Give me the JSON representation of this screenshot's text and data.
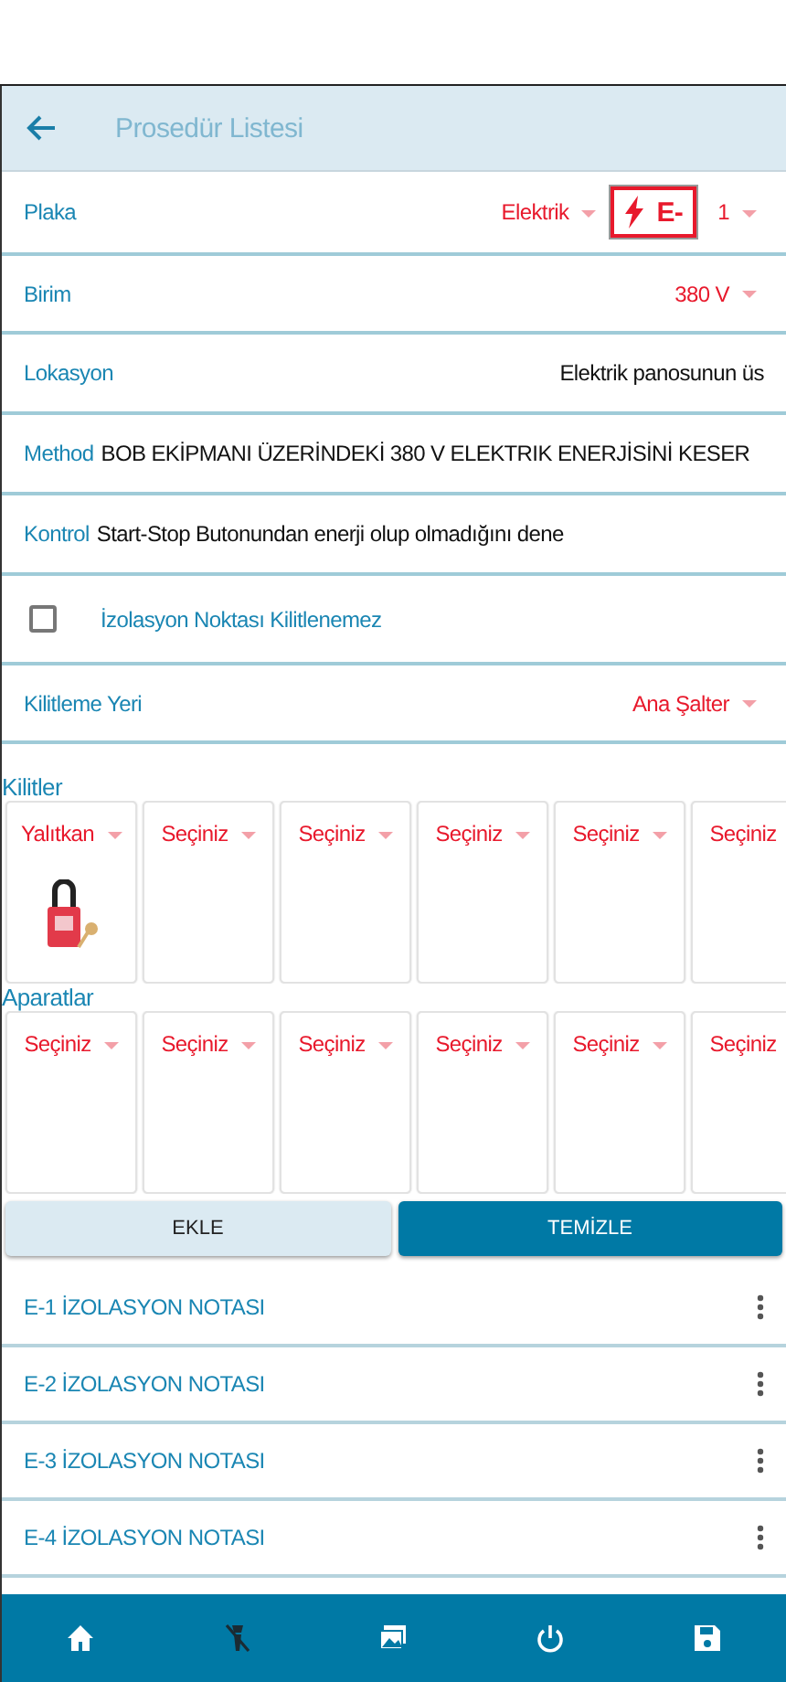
{
  "header": {
    "title": "Prosedür Listesi"
  },
  "fields": [
    {
      "kind": "plaka",
      "label": "Plaka",
      "value": "Elektrik",
      "badge": "E-",
      "number": "1"
    },
    {
      "kind": "select",
      "label": "Birim",
      "value": "380 V"
    },
    {
      "kind": "text",
      "label": "Lokasyon",
      "value": "Elektrik panosunun üs"
    },
    {
      "kind": "inline",
      "label": "Method",
      "value": "BOB EKİPMANI ÜZERİNDEKİ 380 V ELEKTRIK ENERJİSİNİ KESER"
    },
    {
      "kind": "inline",
      "label": "Kontrol",
      "value": "Start-Stop Butonundan enerji olup olmadığını dene"
    },
    {
      "kind": "checkbox",
      "label": "İzolasyon Noktası Kilitlenemez",
      "checked": false
    },
    {
      "kind": "select",
      "label": "Kilitleme Yeri",
      "value": "Ana Şalter"
    }
  ],
  "groups": [
    {
      "title": "Kilitler",
      "slots": [
        {
          "value": "Yalıtkan",
          "kind": "padlock"
        },
        {
          "value": "Seçiniz",
          "kind": "empty"
        },
        {
          "value": "Seçiniz",
          "kind": "empty"
        },
        {
          "value": "Seçiniz",
          "kind": "empty"
        },
        {
          "value": "Seçiniz",
          "kind": "empty"
        },
        {
          "value": "Seçiniz",
          "kind": "empty"
        }
      ]
    },
    {
      "title": "Aparatlar",
      "slots": [
        {
          "value": "Seçiniz",
          "kind": "empty"
        },
        {
          "value": "Seçiniz",
          "kind": "empty"
        },
        {
          "value": "Seçiniz",
          "kind": "empty"
        },
        {
          "value": "Seçiniz",
          "kind": "empty"
        },
        {
          "value": "Seçiniz",
          "kind": "empty"
        },
        {
          "value": "Seçiniz",
          "kind": "empty"
        }
      ]
    }
  ],
  "buttons": [
    {
      "label": "EKLE",
      "primary": false
    },
    {
      "label": "TEMİZLE",
      "primary": true
    }
  ],
  "notes": [
    "E-1 İZOLASYON NOTASI",
    "E-2 İZOLASYON NOTASI",
    "E-3 İZOLASYON NOTASI",
    "E-4 İZOLASYON NOTASI"
  ]
}
